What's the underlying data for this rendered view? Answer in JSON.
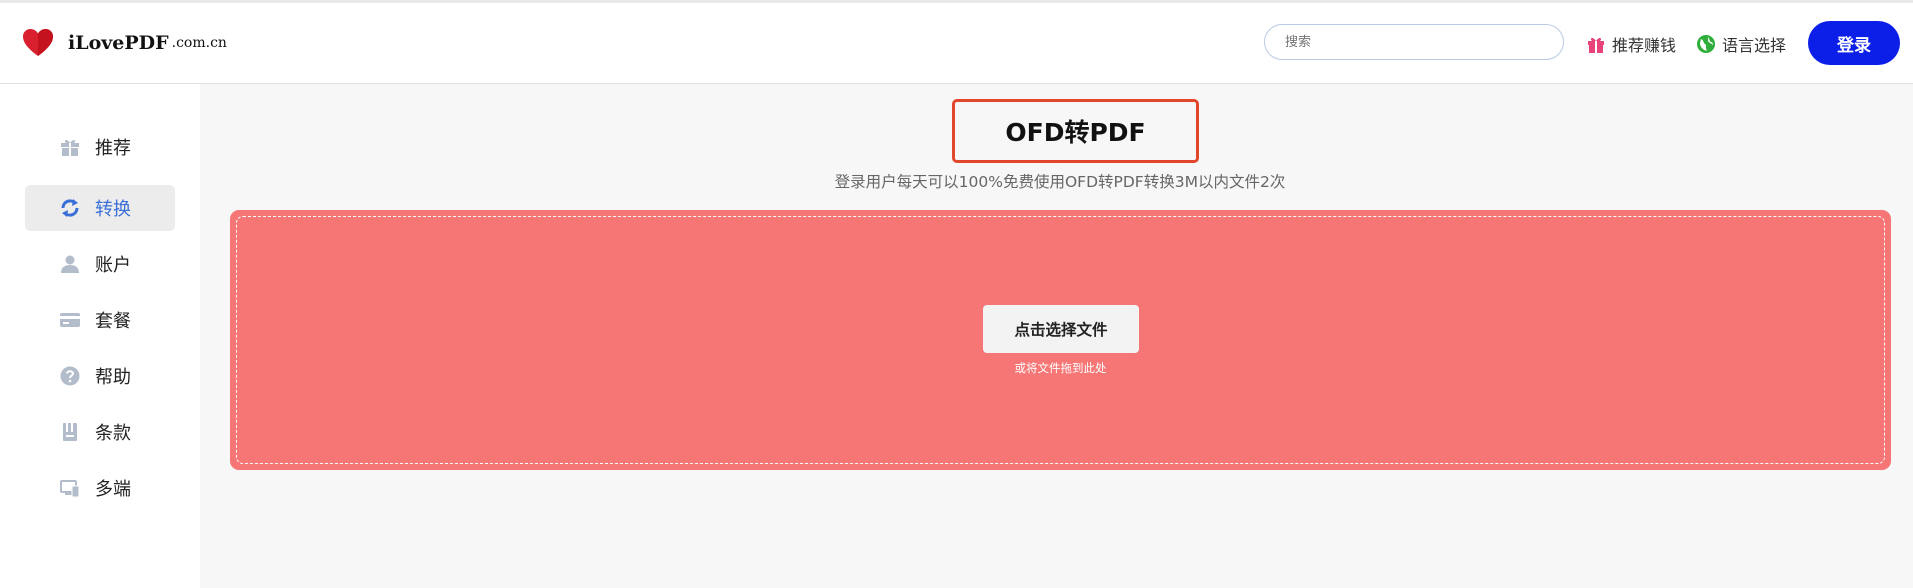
{
  "header": {
    "brand": "iLovePDF",
    "brand_suffix": ".com.cn",
    "search_placeholder": "搜索",
    "referral_label": "推荐赚钱",
    "language_label": "语言选择",
    "login_label": "登录"
  },
  "sidebar": {
    "items": [
      {
        "label": "推荐",
        "icon": "gift-icon"
      },
      {
        "label": "转换",
        "icon": "convert-icon",
        "active": true
      },
      {
        "label": "账户",
        "icon": "user-icon"
      },
      {
        "label": "套餐",
        "icon": "card-icon"
      },
      {
        "label": "帮助",
        "icon": "help-icon"
      },
      {
        "label": "条款",
        "icon": "document-icon"
      },
      {
        "label": "多端",
        "icon": "devices-icon"
      }
    ]
  },
  "main": {
    "title": "OFD转PDF",
    "subtitle": "登录用户每天可以100%免费使用OFD转PDF转换3M以内文件2次",
    "select_button": "点击选择文件",
    "drop_hint": "或将文件拖到此处"
  },
  "colors": {
    "accent": "#0b1fe8",
    "dropzone": "#f67676",
    "title_border": "#e2462b",
    "nav_active_text": "#3a6fd8",
    "brand_heart": "#d8202f"
  }
}
